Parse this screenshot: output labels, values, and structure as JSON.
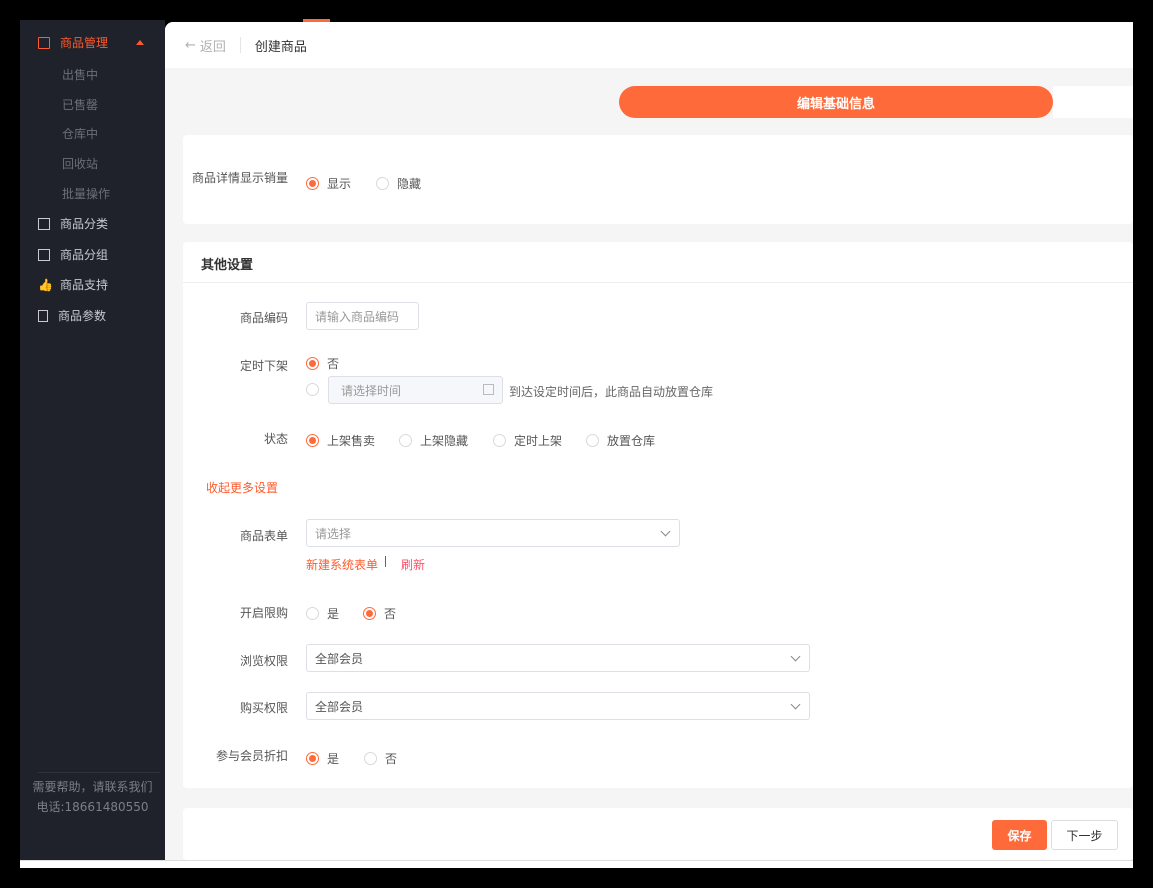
{
  "sidebar": {
    "menu": {
      "label": "商品管理",
      "subitems": [
        "出售中",
        "已售罄",
        "仓库中",
        "回收站",
        "批量操作"
      ]
    },
    "items": [
      {
        "label": "商品分类",
        "icon": "grid-icon"
      },
      {
        "label": "商品分组",
        "icon": "folder-icon"
      },
      {
        "label": "商品支持",
        "icon": "thumbs-up-icon"
      },
      {
        "label": "商品参数",
        "icon": "document-icon"
      }
    ],
    "help": {
      "line1": "需要帮助，请联系我们",
      "line2": "电话:18661480550"
    }
  },
  "header": {
    "back": "返回",
    "title": "创建商品"
  },
  "step": {
    "label": "编辑基础信息"
  },
  "card1": {
    "sales_label": "商品详情显示销量",
    "options": [
      "显示",
      "隐藏"
    ],
    "selected": "显示"
  },
  "other": {
    "title": "其他设置",
    "code_label": "商品编码",
    "code_placeholder": "请输入商品编码",
    "offshelf_label": "定时下架",
    "offshelf_no": "否",
    "time_placeholder": "请选择时间",
    "offshelf_hint": "到达设定时间后，此商品自动放置仓库",
    "status_label": "状态",
    "status_options": [
      "上架售卖",
      "上架隐藏",
      "定时上架",
      "放置仓库"
    ],
    "collapse": "收起更多设置",
    "form_label": "商品表单",
    "form_placeholder": "请选择",
    "new_form": "新建系统表单",
    "refresh": "刷新",
    "limit_label": "开启限购",
    "limit_options": [
      "是",
      "否"
    ],
    "view_label": "浏览权限",
    "view_value": "全部会员",
    "buy_label": "购买权限",
    "buy_value": "全部会员",
    "discount_label": "参与会员折扣",
    "discount_options": [
      "是",
      "否"
    ]
  },
  "footer": {
    "save": "保存",
    "next": "下一步"
  },
  "colors": {
    "accent": "#ff6a3a",
    "sidebar": "#1f222a"
  }
}
